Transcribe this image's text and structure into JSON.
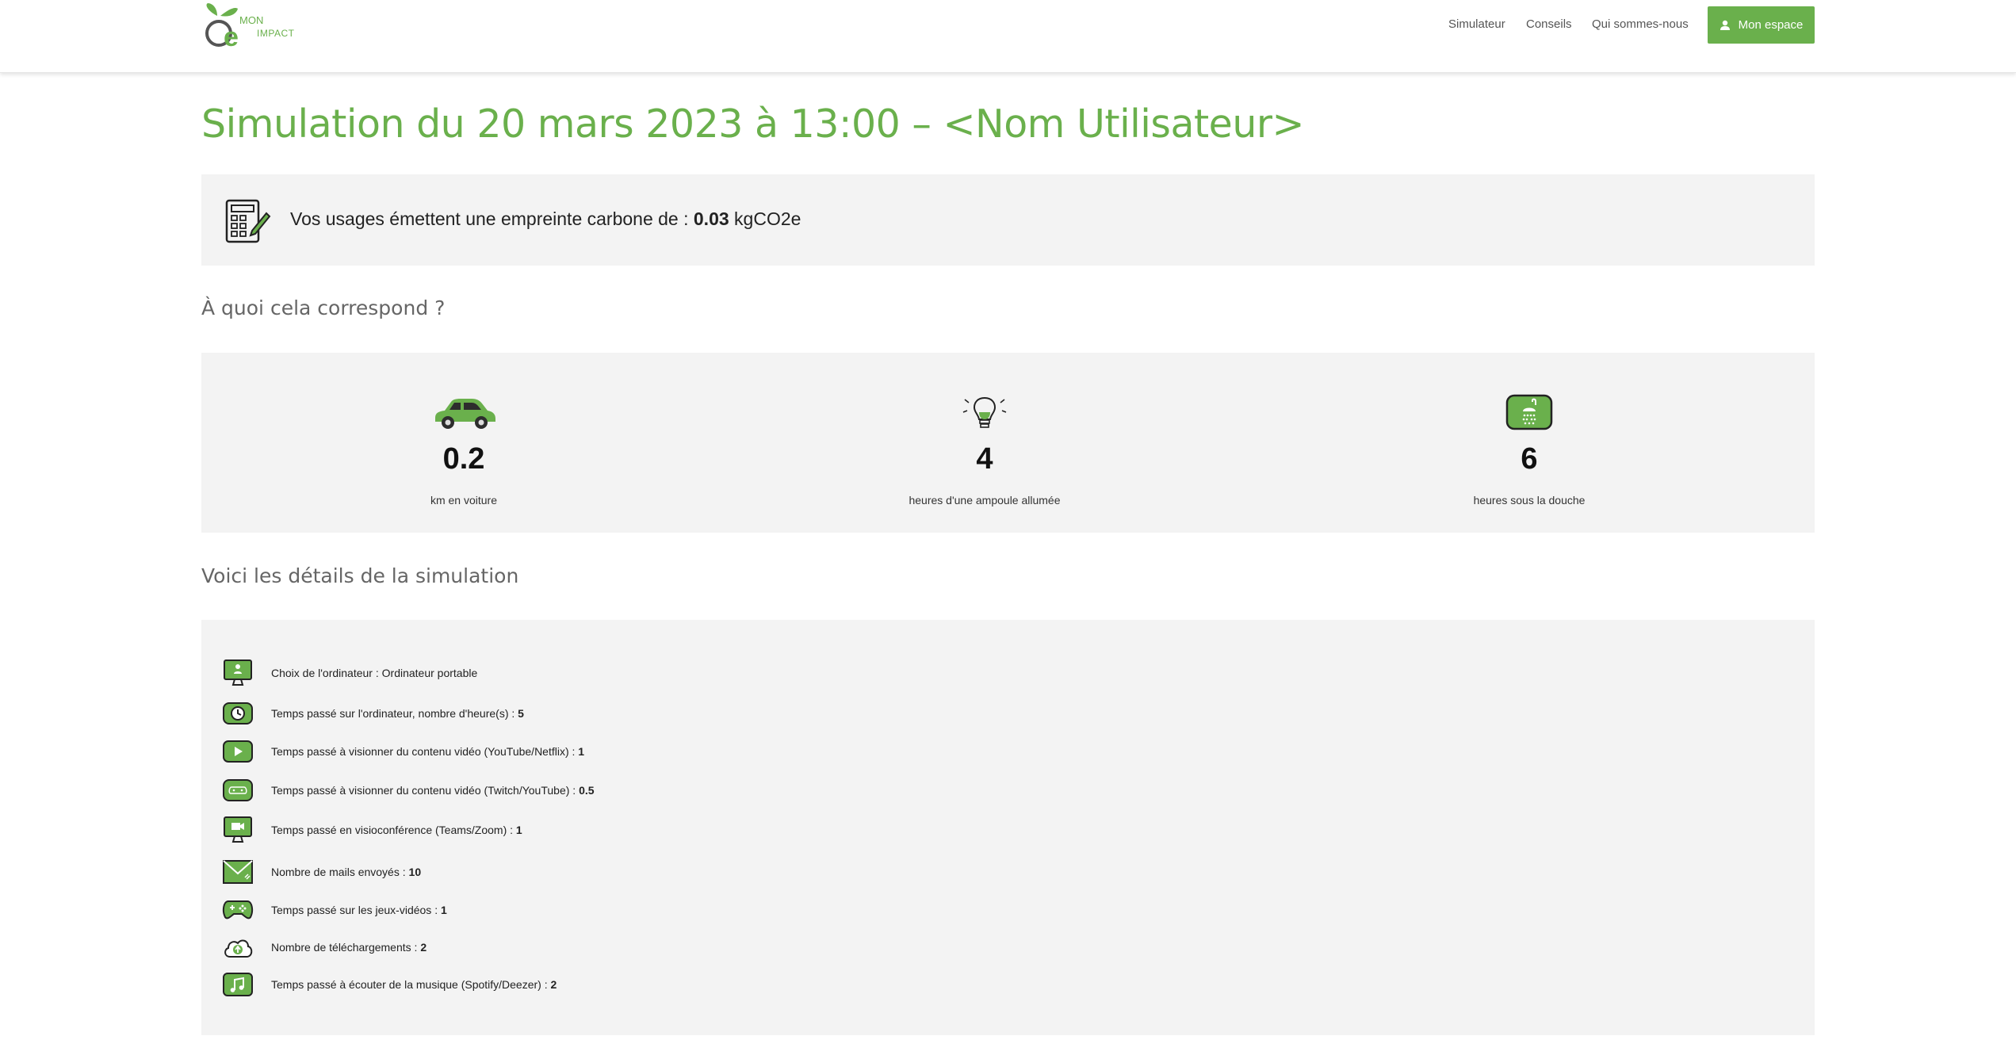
{
  "header": {
    "logo_mon": "MON",
    "logo_impact": "IMPACT",
    "nav": [
      "Simulateur",
      "Conseils",
      "Qui sommes-nous"
    ],
    "account_button": "Mon espace",
    "accent_color": "#6ab04c"
  },
  "page": {
    "title": "Simulation du 20 mars 2023 à 13:00 – <Nom Utilisateur>"
  },
  "result": {
    "icon": "calculator-icon",
    "prefix": "Vos usages émettent une empreinte carbone de :",
    "value": "0.03",
    "unit": "kgCO2e"
  },
  "equivalents": {
    "heading": "À quoi cela correspond ?",
    "items": [
      {
        "icon": "car-icon",
        "value": "0.2",
        "label": "km en voiture"
      },
      {
        "icon": "lightbulb-icon",
        "value": "4",
        "label": "heures d'une ampoule allumée"
      },
      {
        "icon": "shower-icon",
        "value": "6",
        "label": "heures sous la douche"
      }
    ]
  },
  "details": {
    "heading": "Voici les détails de la simulation",
    "items": [
      {
        "icon": "computer-icon",
        "label": "Choix de l'ordinateur : Ordinateur portable",
        "value": ""
      },
      {
        "icon": "clock-icon",
        "label": "Temps passé sur l'ordinateur, nombre d'heure(s) :",
        "value": "5"
      },
      {
        "icon": "play-icon",
        "label": "Temps passé à visionner du contenu vidéo (YouTube/Netflix) :",
        "value": "1"
      },
      {
        "icon": "gamepad-stream-icon",
        "label": "Temps passé à visionner du contenu vidéo (Twitch/YouTube) :",
        "value": "0.5"
      },
      {
        "icon": "video-conference-icon",
        "label": "Temps passé en visioconférence (Teams/Zoom) :",
        "value": "1"
      },
      {
        "icon": "mail-icon",
        "label": "Nombre de mails envoyés :",
        "value": "10"
      },
      {
        "icon": "gamepad-icon",
        "label": "Temps passé sur les jeux-vidéos :",
        "value": "1"
      },
      {
        "icon": "cloud-upload-icon",
        "label": "Nombre de téléchargements :",
        "value": "2"
      },
      {
        "icon": "music-icon",
        "label": "Temps passé à écouter de la musique (Spotify/Deezer) :",
        "value": "2"
      }
    ]
  }
}
